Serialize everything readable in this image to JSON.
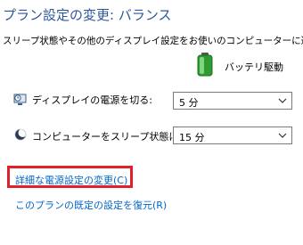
{
  "header": {
    "title": "プラン設定の変更: バランス",
    "subtitle": "スリープ状態やその他のディスプレイ設定をお使いのコンピューターに適用するま"
  },
  "column": {
    "battery_label": "バッテリ駆動"
  },
  "settings": {
    "display_off_label": "ディスプレイの電源を切る:",
    "display_off_value": "5 分",
    "sleep_label": "コンピューターをスリープ状態にする:",
    "sleep_value": "15 分"
  },
  "links": {
    "advanced": "詳細な電源設定の変更(C)",
    "restore": "このプランの既定の設定を復元(R)"
  },
  "colors": {
    "title": "#2b579a",
    "link": "#0066cc",
    "highlight": "#e0202c",
    "battery_green": "#3cb43c"
  },
  "icons": {
    "battery": "battery-icon",
    "display": "monitor-clock-icon",
    "sleep": "moon-icon",
    "dropdown": "chevron-down-icon"
  }
}
